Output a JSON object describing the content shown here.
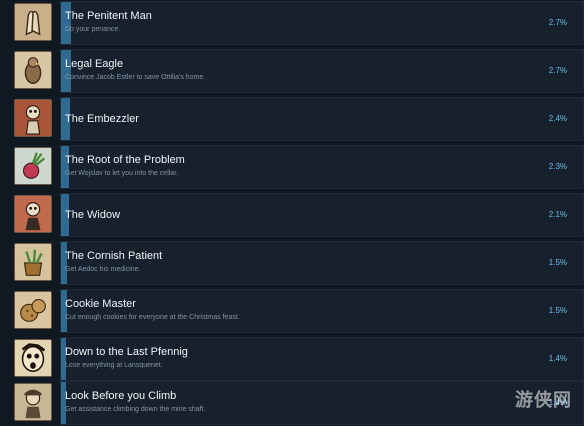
{
  "achievements": [
    {
      "title": "The Penitent Man",
      "description": "Do your penance.",
      "percent_label": "2.7%",
      "percent": 2.7,
      "icon": "praying-hands-icon"
    },
    {
      "title": "Legal Eagle",
      "description": "Convince Jacob Estler to save Ottilia's home.",
      "percent_label": "2.7%",
      "percent": 2.7,
      "icon": "eagle-icon"
    },
    {
      "title": "The Embezzler",
      "description": "",
      "percent_label": "2.4%",
      "percent": 2.4,
      "icon": "skeleton-icon"
    },
    {
      "title": "The Root of the Problem",
      "description": "Get Wojslav to let you into the cellar.",
      "percent_label": "2.3%",
      "percent": 2.3,
      "icon": "radish-icon"
    },
    {
      "title": "The Widow",
      "description": "",
      "percent_label": "2.1%",
      "percent": 2.1,
      "icon": "widow-skeleton-icon"
    },
    {
      "title": "The Cornish Patient",
      "description": "Get Aedoc his medicine.",
      "percent_label": "1.5%",
      "percent": 1.5,
      "icon": "herb-pot-icon"
    },
    {
      "title": "Cookie Master",
      "description": "Cut enough cookies for everyone at the Christmas feast.",
      "percent_label": "1.5%",
      "percent": 1.5,
      "icon": "cookie-icon"
    },
    {
      "title": "Down to the Last Pfennig",
      "description": "Lose everything at Lansquenet.",
      "percent_label": "1.4%",
      "percent": 1.4,
      "icon": "shocked-face-icon"
    },
    {
      "title": "Look Before you Climb",
      "description": "Get assistance climbing down the mine shaft.",
      "percent_label": "1.4%",
      "percent": 1.4,
      "icon": "climber-icon"
    }
  ],
  "watermark": "游侠网",
  "colors": {
    "bar": "#2f6a92",
    "percent": "#66c0f4",
    "panel": "#17202d"
  }
}
